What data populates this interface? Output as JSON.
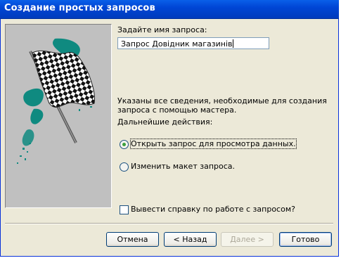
{
  "window": {
    "title": "Создание простых запросов"
  },
  "form": {
    "name_label": "Задайте имя запроса:",
    "name_value": "Запрос Довідник магазинів",
    "info_line1": "Указаны все сведения, необходимые для создания",
    "info_line2": "запроса с помощью мастера.",
    "actions_label": "Дальнейшие действия:",
    "options": [
      {
        "label": "Открыть запрос для просмотра данных.",
        "selected": true
      },
      {
        "label": "Изменить макет запроса.",
        "selected": false
      }
    ],
    "help_checkbox": {
      "label": "Вывести справку по работе с запросом?",
      "checked": false
    }
  },
  "buttons": {
    "cancel": "Отмена",
    "back": "< Назад",
    "next": "Далее >",
    "finish": "Готово"
  },
  "colors": {
    "titlebar": "#0046d5",
    "dialog_bg": "#ece9d8",
    "picture_bg": "#c0c0c0",
    "flag_teal": "#0f8a80"
  },
  "icons": {
    "wizard_image": "checkered-flag-icon"
  }
}
